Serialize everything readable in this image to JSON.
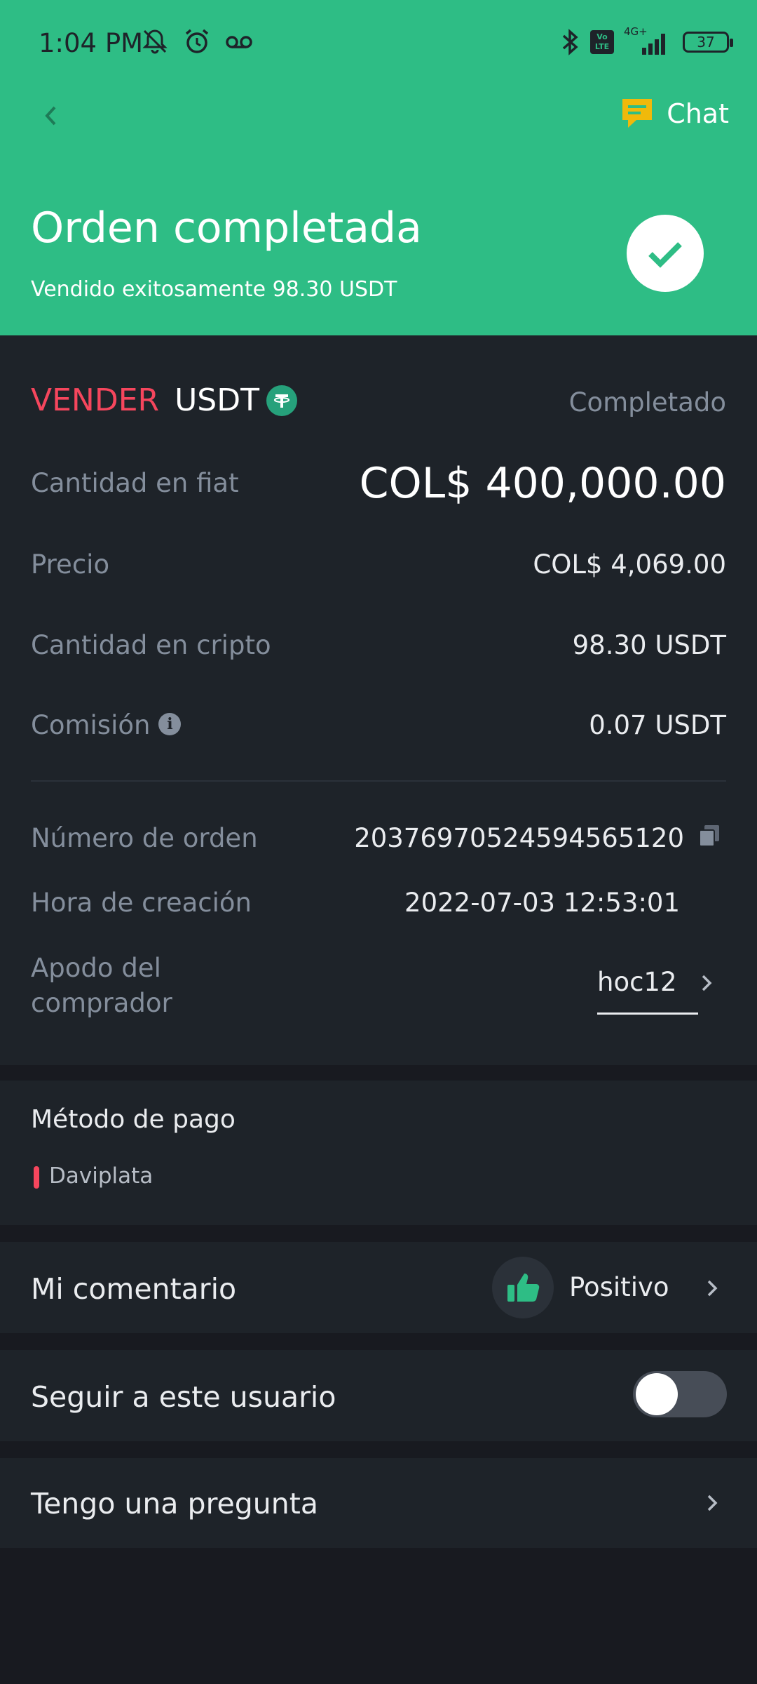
{
  "status_bar": {
    "time": "1:04 PM",
    "network": "4G+",
    "volte": "Vo LTE",
    "battery": "37"
  },
  "header": {
    "chat_label": "Chat",
    "title": "Orden completada",
    "subtitle": "Vendido exitosamente  98.30 USDT"
  },
  "order": {
    "side": "VENDER",
    "asset": "USDT",
    "status": "Completado",
    "rows": [
      {
        "label": "Cantidad en fiat",
        "value": "COL$ 400,000.00"
      },
      {
        "label": "Precio",
        "value": "COL$ 4,069.00"
      },
      {
        "label": "Cantidad en cripto",
        "value": "98.30 USDT"
      },
      {
        "label": "Comisión",
        "value": "0.07 USDT"
      }
    ],
    "order_number_label": "Número de orden",
    "order_number": "20376970524594565120",
    "created_label": "Hora de creación",
    "created_value": "2022-07-03 12:53:01",
    "buyer_label_line1": "Apodo del",
    "buyer_label_line2": "comprador",
    "buyer_name": "hoc12"
  },
  "payment": {
    "title": "Método de pago",
    "method": "Daviplata",
    "method_color": "#f6465d"
  },
  "comment": {
    "label": "Mi comentario",
    "value": "Positivo"
  },
  "follow": {
    "label": "Seguir a este usuario",
    "enabled": false
  },
  "question": {
    "label": "Tengo una pregunta"
  },
  "colors": {
    "accent": "#2ebd85",
    "sell": "#f6465d",
    "background": "#181a20",
    "card": "#1e2329"
  }
}
